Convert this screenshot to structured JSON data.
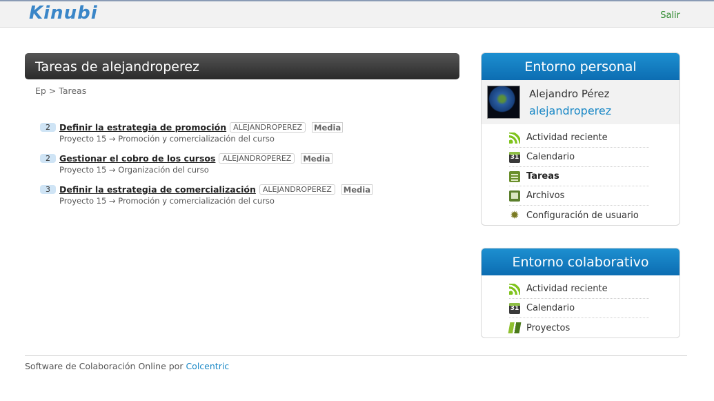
{
  "header": {
    "logo_text": "Kinubi",
    "logout_label": "Salir"
  },
  "main": {
    "title": "Tareas de alejandroperez",
    "breadcrumb": "Ep > Tareas",
    "tasks": [
      {
        "count": "2",
        "title": "Definir la estrategia de promoción",
        "assignee": "ALEJANDROPEREZ",
        "priority": "Media",
        "path": "Proyecto 15 → Promoción y comercialización del curso"
      },
      {
        "count": "2",
        "title": "Gestionar el cobro de los cursos",
        "assignee": "ALEJANDROPEREZ",
        "priority": "Media",
        "path": "Proyecto 15 → Organización del curso"
      },
      {
        "count": "3",
        "title": "Definir la estrategia de comercialización",
        "assignee": "ALEJANDROPEREZ",
        "priority": "Media",
        "path": "Proyecto 15 → Promoción y comercialización del curso"
      }
    ]
  },
  "personal_panel": {
    "title": "Entorno personal",
    "user_full_name": "Alejandro Pérez",
    "username": "alejandroperez",
    "items": [
      {
        "label": "Actividad reciente",
        "icon": "rss-icon"
      },
      {
        "label": "Calendario",
        "icon": "calendar-icon",
        "icon_text": "31"
      },
      {
        "label": "Tareas",
        "icon": "tasks-icon",
        "active": true
      },
      {
        "label": "Archivos",
        "icon": "files-icon"
      },
      {
        "label": "Configuración de usuario",
        "icon": "gear-icon"
      }
    ]
  },
  "collab_panel": {
    "title": "Entorno colaborativo",
    "items": [
      {
        "label": "Actividad reciente",
        "icon": "rss-icon"
      },
      {
        "label": "Calendario",
        "icon": "calendar-icon",
        "icon_text": "31"
      },
      {
        "label": "Proyectos",
        "icon": "projects-icon"
      }
    ]
  },
  "footer": {
    "text": "Software de Colaboración Online por ",
    "link": "Colcentric"
  },
  "colors": {
    "panel_header": "#0c6db2",
    "link": "#1a88c6",
    "logout": "#2f8a2f",
    "title_bar": "#2a2a2a"
  }
}
